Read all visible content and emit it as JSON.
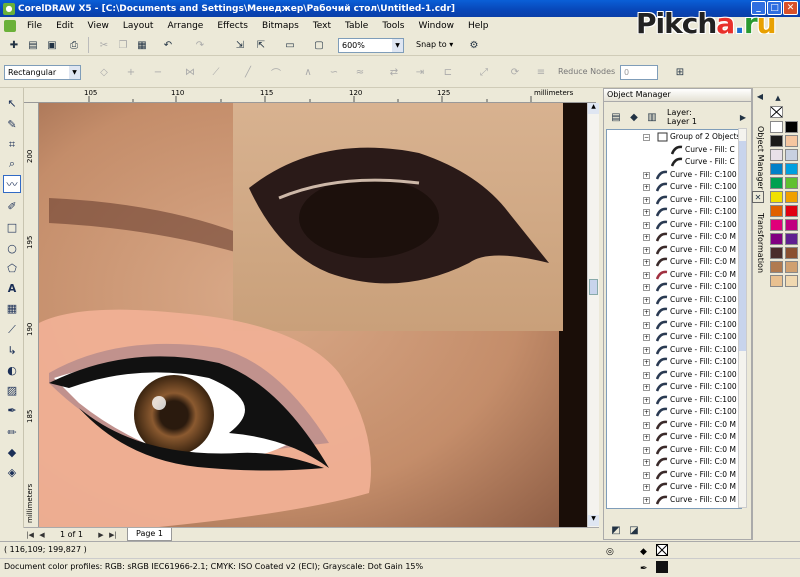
{
  "window": {
    "title": "CorelDRAW X5 - [C:\\Documents and Settings\\Менеджер\\Рабочий стол\\Untitled-1.cdr]"
  },
  "menu": [
    "File",
    "Edit",
    "View",
    "Layout",
    "Arrange",
    "Effects",
    "Bitmaps",
    "Text",
    "Table",
    "Tools",
    "Window",
    "Help"
  ],
  "toolbar": {
    "zoom": "600%",
    "snap_to": "Snap to"
  },
  "property_bar": {
    "shape_mode": "Rectangular",
    "reduce_nodes_label": "Reduce Nodes",
    "reduce_nodes_value": "0"
  },
  "ruler": {
    "h_labels": [
      "105",
      "110",
      "115",
      "120",
      "125"
    ],
    "v_labels": [
      "200",
      "195",
      "190",
      "185"
    ],
    "units": "millimeters"
  },
  "page_nav": {
    "position": "1 of 1",
    "page_tab": "Page 1"
  },
  "object_manager": {
    "title": "Object Manager",
    "layer_label": "Layer:",
    "layer_name": "Layer 1",
    "group": "Group of 2 Objects",
    "items": [
      {
        "label": "Curve - Fill: C",
        "child": true,
        "color": "#222"
      },
      {
        "label": "Curve - Fill: C",
        "child": true,
        "color": "#222"
      },
      {
        "label": "Curve - Fill: C:100",
        "color": "#2a3a52"
      },
      {
        "label": "Curve - Fill: C:100",
        "color": "#2a3a52"
      },
      {
        "label": "Curve - Fill: C:100",
        "color": "#2a3a52"
      },
      {
        "label": "Curve - Fill: C:100",
        "color": "#2a3a52"
      },
      {
        "label": "Curve - Fill: C:100",
        "color": "#2a3a52"
      },
      {
        "label": "Curve - Fill: C:0 M",
        "color": "#3a2a2a"
      },
      {
        "label": "Curve - Fill: C:0 M",
        "color": "#3a2a2a"
      },
      {
        "label": "Curve - Fill: C:0 M",
        "color": "#3a2a2a"
      },
      {
        "label": "Curve - Fill: C:0 M",
        "color": "#a03040"
      },
      {
        "label": "Curve - Fill: C:100",
        "color": "#2a3a52"
      },
      {
        "label": "Curve - Fill: C:100",
        "color": "#2a3a52"
      },
      {
        "label": "Curve - Fill: C:100",
        "color": "#2a3a52"
      },
      {
        "label": "Curve - Fill: C:100",
        "color": "#2a3a52"
      },
      {
        "label": "Curve - Fill: C:100",
        "color": "#2a3a52"
      },
      {
        "label": "Curve - Fill: C:100",
        "color": "#2a3a52"
      },
      {
        "label": "Curve - Fill: C:100",
        "color": "#2a3a52"
      },
      {
        "label": "Curve - Fill: C:100",
        "color": "#2a3a52"
      },
      {
        "label": "Curve - Fill: C:100",
        "color": "#2a3a52"
      },
      {
        "label": "Curve - Fill: C:100",
        "color": "#2a3a52"
      },
      {
        "label": "Curve - Fill: C:100",
        "color": "#2a3a52"
      },
      {
        "label": "Curve - Fill: C:0 M",
        "color": "#3a2a2a"
      },
      {
        "label": "Curve - Fill: C:0 M",
        "color": "#3a2a2a"
      },
      {
        "label": "Curve - Fill: C:0 M",
        "color": "#3a2a2a"
      },
      {
        "label": "Curve - Fill: C:0 M",
        "color": "#3a2a2a"
      },
      {
        "label": "Curve - Fill: C:0 M",
        "color": "#3a2a2a"
      },
      {
        "label": "Curve - Fill: C:0 M",
        "color": "#3a2a2a"
      },
      {
        "label": "Curve - Fill: C:0 M",
        "color": "#3a2a2a"
      }
    ]
  },
  "dockers": {
    "tab1": "Object Manager",
    "tab2": "Transformation"
  },
  "palette": [
    "#ffffff",
    "#000000",
    "#1a1a1a",
    "#f5c6a0",
    "#e8e0e8",
    "#c8d0e0",
    "#0080c8",
    "#00a0e0",
    "#00a050",
    "#60c030",
    "#f0e000",
    "#f0a000",
    "#e06000",
    "#e00010",
    "#e0007a",
    "#c00080",
    "#800080",
    "#602090",
    "#4a2c2a",
    "#8a5030",
    "#b07a50",
    "#d0a070",
    "#e8c090",
    "#f0d8b0"
  ],
  "status": {
    "coords": "( 116,109; 199,827 )",
    "profiles": "Document color profiles: RGB: sRGB IEC61966-2.1; CMYK: ISO Coated v2 (ECI); Grayscale: Dot Gain 15%"
  },
  "watermark": "Pikcha.ru"
}
